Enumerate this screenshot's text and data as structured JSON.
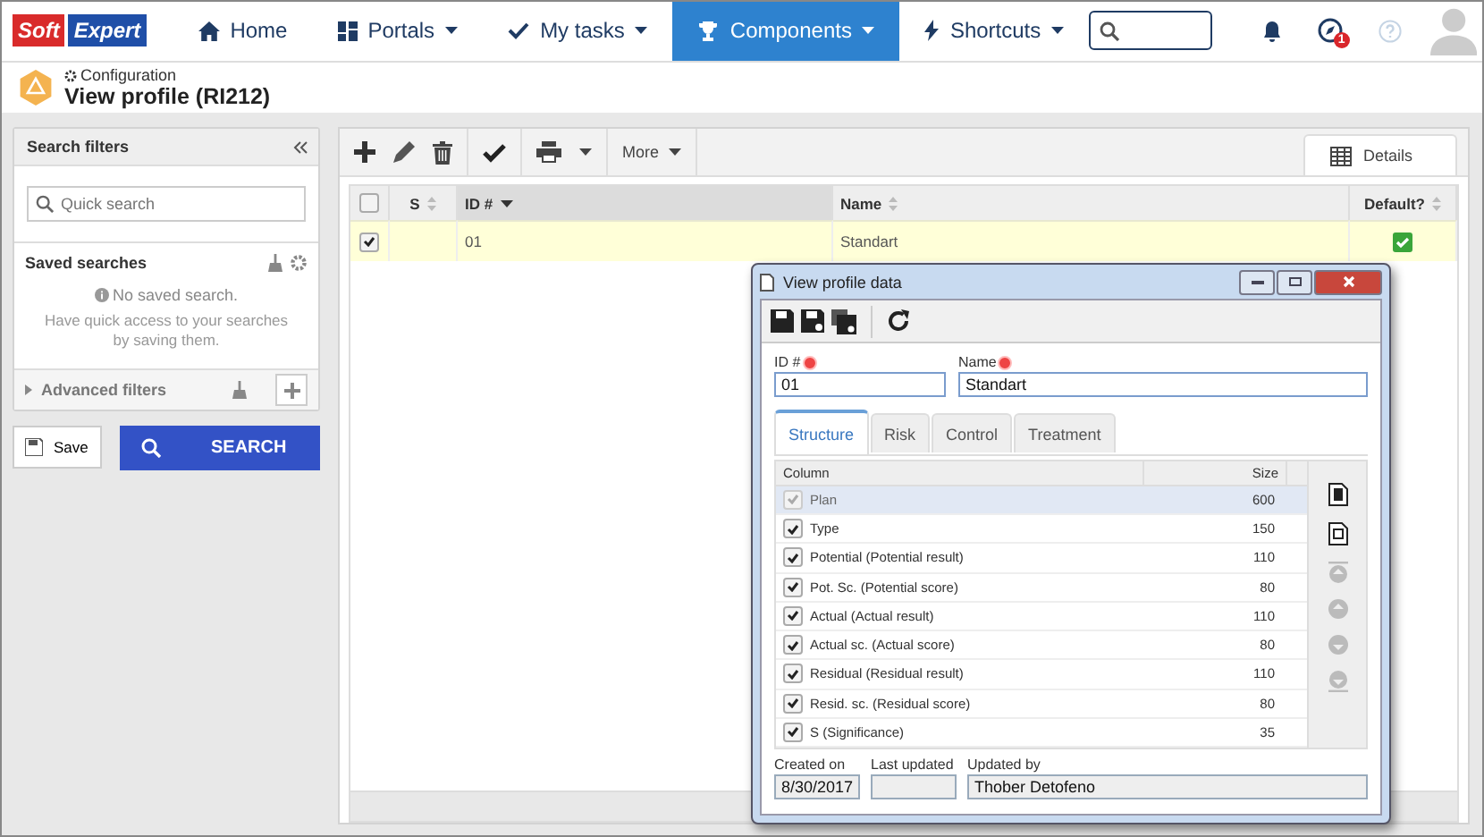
{
  "topbar": {
    "logo": [
      "Soft",
      "Expert"
    ],
    "nav": [
      {
        "label": "Home",
        "kind": "home",
        "dropdown": false,
        "selected": false
      },
      {
        "label": "Portals",
        "kind": "portals",
        "dropdown": true,
        "selected": false
      },
      {
        "label": "My tasks",
        "kind": "tasks",
        "dropdown": true,
        "selected": false
      },
      {
        "label": "Components",
        "kind": "components",
        "dropdown": true,
        "selected": true
      },
      {
        "label": "Shortcuts",
        "kind": "shortcuts",
        "dropdown": true,
        "selected": false
      }
    ],
    "notification_badge": "1"
  },
  "header": {
    "breadcrumb": "Configuration",
    "title": "View profile (RI212)"
  },
  "search_filters": {
    "title": "Search filters",
    "quick_search": {
      "placeholder": "Quick search"
    },
    "saved_searches": {
      "title": "Saved searches",
      "empty_title": "No saved search.",
      "empty_text": "Have quick access to your searches by saving them."
    },
    "advanced_filters": "Advanced filters",
    "save_button": "Save",
    "search_button": "SEARCH"
  },
  "toolbar": {
    "more": "More",
    "details_tab": "Details"
  },
  "table": {
    "columns": [
      "S",
      "ID #",
      "Name",
      "Default?"
    ],
    "header_checked": false,
    "rows": [
      {
        "checked": true,
        "selected": true,
        "s": "",
        "id": "01",
        "name": "Standart",
        "default": true
      }
    ]
  },
  "dialog": {
    "title": "View profile data",
    "id_label": "ID #",
    "id_value": "01",
    "name_label": "Name",
    "name_value": "Standart",
    "tabs": [
      {
        "label": "Structure",
        "selected": true
      },
      {
        "label": "Risk",
        "selected": false
      },
      {
        "label": "Control",
        "selected": false
      },
      {
        "label": "Treatment",
        "selected": false
      }
    ],
    "list_columns": [
      "Column",
      "Size"
    ],
    "rows": [
      {
        "label": "Plan",
        "size": "600",
        "checked": true,
        "disabled": true,
        "selected": true
      },
      {
        "label": "Type",
        "size": "150",
        "checked": true,
        "disabled": false,
        "selected": false
      },
      {
        "label": "Potential (Potential result)",
        "size": "110",
        "checked": true,
        "disabled": false,
        "selected": false
      },
      {
        "label": "Pot. Sc. (Potential score)",
        "size": "80",
        "checked": true,
        "disabled": false,
        "selected": false
      },
      {
        "label": "Actual (Actual result)",
        "size": "110",
        "checked": true,
        "disabled": false,
        "selected": false
      },
      {
        "label": "Actual sc. (Actual score)",
        "size": "80",
        "checked": true,
        "disabled": false,
        "selected": false
      },
      {
        "label": "Residual (Residual result)",
        "size": "110",
        "checked": true,
        "disabled": false,
        "selected": false
      },
      {
        "label": "Resid. sc. (Residual score)",
        "size": "80",
        "checked": true,
        "disabled": false,
        "selected": false
      },
      {
        "label": "S (Significance)",
        "size": "35",
        "checked": true,
        "disabled": false,
        "selected": false
      }
    ],
    "created_label": "Created on",
    "created_value": "8/30/2017",
    "updated_label": "Last updated",
    "updated_by_label": "Updated by",
    "updated_by_value": "Thober Detofeno"
  }
}
